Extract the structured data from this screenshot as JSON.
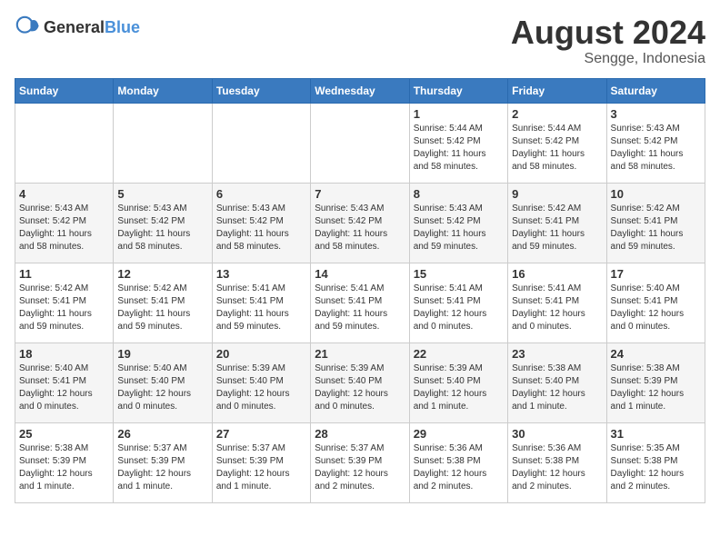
{
  "header": {
    "logo_general": "General",
    "logo_blue": "Blue",
    "month_year": "August 2024",
    "location": "Sengge, Indonesia"
  },
  "weekdays": [
    "Sunday",
    "Monday",
    "Tuesday",
    "Wednesday",
    "Thursday",
    "Friday",
    "Saturday"
  ],
  "weeks": [
    [
      {
        "day": "",
        "content": ""
      },
      {
        "day": "",
        "content": ""
      },
      {
        "day": "",
        "content": ""
      },
      {
        "day": "",
        "content": ""
      },
      {
        "day": "1",
        "content": "Sunrise: 5:44 AM\nSunset: 5:42 PM\nDaylight: 11 hours\nand 58 minutes."
      },
      {
        "day": "2",
        "content": "Sunrise: 5:44 AM\nSunset: 5:42 PM\nDaylight: 11 hours\nand 58 minutes."
      },
      {
        "day": "3",
        "content": "Sunrise: 5:43 AM\nSunset: 5:42 PM\nDaylight: 11 hours\nand 58 minutes."
      }
    ],
    [
      {
        "day": "4",
        "content": "Sunrise: 5:43 AM\nSunset: 5:42 PM\nDaylight: 11 hours\nand 58 minutes."
      },
      {
        "day": "5",
        "content": "Sunrise: 5:43 AM\nSunset: 5:42 PM\nDaylight: 11 hours\nand 58 minutes."
      },
      {
        "day": "6",
        "content": "Sunrise: 5:43 AM\nSunset: 5:42 PM\nDaylight: 11 hours\nand 58 minutes."
      },
      {
        "day": "7",
        "content": "Sunrise: 5:43 AM\nSunset: 5:42 PM\nDaylight: 11 hours\nand 58 minutes."
      },
      {
        "day": "8",
        "content": "Sunrise: 5:43 AM\nSunset: 5:42 PM\nDaylight: 11 hours\nand 59 minutes."
      },
      {
        "day": "9",
        "content": "Sunrise: 5:42 AM\nSunset: 5:41 PM\nDaylight: 11 hours\nand 59 minutes."
      },
      {
        "day": "10",
        "content": "Sunrise: 5:42 AM\nSunset: 5:41 PM\nDaylight: 11 hours\nand 59 minutes."
      }
    ],
    [
      {
        "day": "11",
        "content": "Sunrise: 5:42 AM\nSunset: 5:41 PM\nDaylight: 11 hours\nand 59 minutes."
      },
      {
        "day": "12",
        "content": "Sunrise: 5:42 AM\nSunset: 5:41 PM\nDaylight: 11 hours\nand 59 minutes."
      },
      {
        "day": "13",
        "content": "Sunrise: 5:41 AM\nSunset: 5:41 PM\nDaylight: 11 hours\nand 59 minutes."
      },
      {
        "day": "14",
        "content": "Sunrise: 5:41 AM\nSunset: 5:41 PM\nDaylight: 11 hours\nand 59 minutes."
      },
      {
        "day": "15",
        "content": "Sunrise: 5:41 AM\nSunset: 5:41 PM\nDaylight: 12 hours\nand 0 minutes."
      },
      {
        "day": "16",
        "content": "Sunrise: 5:41 AM\nSunset: 5:41 PM\nDaylight: 12 hours\nand 0 minutes."
      },
      {
        "day": "17",
        "content": "Sunrise: 5:40 AM\nSunset: 5:41 PM\nDaylight: 12 hours\nand 0 minutes."
      }
    ],
    [
      {
        "day": "18",
        "content": "Sunrise: 5:40 AM\nSunset: 5:41 PM\nDaylight: 12 hours\nand 0 minutes."
      },
      {
        "day": "19",
        "content": "Sunrise: 5:40 AM\nSunset: 5:40 PM\nDaylight: 12 hours\nand 0 minutes."
      },
      {
        "day": "20",
        "content": "Sunrise: 5:39 AM\nSunset: 5:40 PM\nDaylight: 12 hours\nand 0 minutes."
      },
      {
        "day": "21",
        "content": "Sunrise: 5:39 AM\nSunset: 5:40 PM\nDaylight: 12 hours\nand 0 minutes."
      },
      {
        "day": "22",
        "content": "Sunrise: 5:39 AM\nSunset: 5:40 PM\nDaylight: 12 hours\nand 1 minute."
      },
      {
        "day": "23",
        "content": "Sunrise: 5:38 AM\nSunset: 5:40 PM\nDaylight: 12 hours\nand 1 minute."
      },
      {
        "day": "24",
        "content": "Sunrise: 5:38 AM\nSunset: 5:39 PM\nDaylight: 12 hours\nand 1 minute."
      }
    ],
    [
      {
        "day": "25",
        "content": "Sunrise: 5:38 AM\nSunset: 5:39 PM\nDaylight: 12 hours\nand 1 minute."
      },
      {
        "day": "26",
        "content": "Sunrise: 5:37 AM\nSunset: 5:39 PM\nDaylight: 12 hours\nand 1 minute."
      },
      {
        "day": "27",
        "content": "Sunrise: 5:37 AM\nSunset: 5:39 PM\nDaylight: 12 hours\nand 1 minute."
      },
      {
        "day": "28",
        "content": "Sunrise: 5:37 AM\nSunset: 5:39 PM\nDaylight: 12 hours\nand 2 minutes."
      },
      {
        "day": "29",
        "content": "Sunrise: 5:36 AM\nSunset: 5:38 PM\nDaylight: 12 hours\nand 2 minutes."
      },
      {
        "day": "30",
        "content": "Sunrise: 5:36 AM\nSunset: 5:38 PM\nDaylight: 12 hours\nand 2 minutes."
      },
      {
        "day": "31",
        "content": "Sunrise: 5:35 AM\nSunset: 5:38 PM\nDaylight: 12 hours\nand 2 minutes."
      }
    ]
  ]
}
